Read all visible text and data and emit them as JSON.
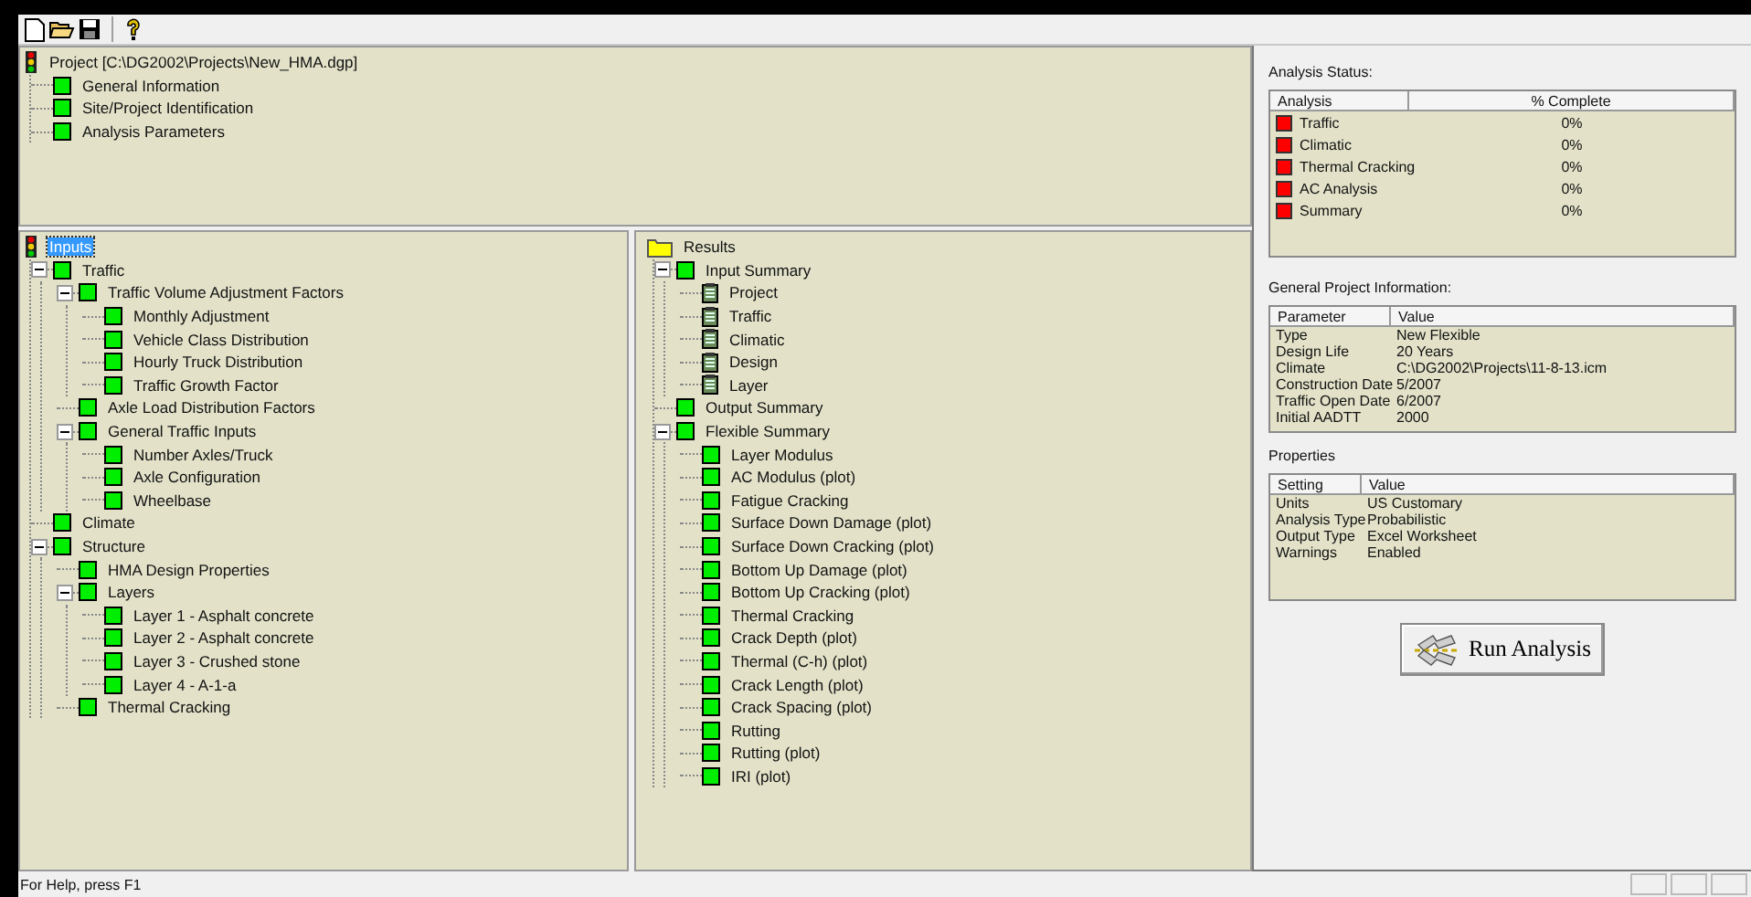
{
  "toolbar": [
    {
      "kind": "new"
    },
    {
      "kind": "open"
    },
    {
      "kind": "save"
    },
    {
      "kind": "separator"
    },
    {
      "kind": "help"
    }
  ],
  "project_tree": {
    "label": "Project [C:\\DG2002\\Projects\\New_HMA.dgp]",
    "kind": "signal",
    "selected": false,
    "children": [
      {
        "label": "General Information",
        "kind": "status",
        "selected": false
      },
      {
        "label": "Site/Project Identification",
        "kind": "status",
        "selected": false
      },
      {
        "label": "Analysis Parameters",
        "kind": "status",
        "selected": false
      }
    ]
  },
  "inputs_tree": {
    "label": "Inputs",
    "kind": "signal",
    "selected": true,
    "children": [
      {
        "label": "Traffic",
        "kind": "status",
        "selected": false,
        "expanded": true,
        "children": [
          {
            "label": "Traffic Volume Adjustment Factors",
            "kind": "status",
            "selected": false,
            "expanded": true,
            "children": [
              {
                "label": "Monthly Adjustment",
                "kind": "status",
                "selected": false
              },
              {
                "label": "Vehicle Class Distribution",
                "kind": "status",
                "selected": false
              },
              {
                "label": "Hourly Truck Distribution",
                "kind": "status",
                "selected": false
              },
              {
                "label": "Traffic Growth Factor",
                "kind": "status",
                "selected": false
              }
            ]
          },
          {
            "label": "Axle Load Distribution Factors",
            "kind": "status",
            "selected": false
          },
          {
            "label": "General Traffic Inputs",
            "kind": "status",
            "selected": false,
            "expanded": true,
            "children": [
              {
                "label": "Number Axles/Truck",
                "kind": "status",
                "selected": false
              },
              {
                "label": "Axle Configuration",
                "kind": "status",
                "selected": false
              },
              {
                "label": "Wheelbase",
                "kind": "status",
                "selected": false
              }
            ]
          }
        ]
      },
      {
        "label": "Climate",
        "kind": "status",
        "selected": false
      },
      {
        "label": "Structure",
        "kind": "status",
        "selected": false,
        "expanded": true,
        "children": [
          {
            "label": "HMA Design Properties",
            "kind": "status",
            "selected": false
          },
          {
            "label": "Layers",
            "kind": "status",
            "selected": false,
            "expanded": true,
            "children": [
              {
                "label": "Layer 1 - Asphalt concrete",
                "kind": "status",
                "selected": false
              },
              {
                "label": "Layer 2 - Asphalt concrete",
                "kind": "status",
                "selected": false
              },
              {
                "label": "Layer 3 - Crushed stone",
                "kind": "status",
                "selected": false
              },
              {
                "label": "Layer 4 - A-1-a",
                "kind": "status",
                "selected": false
              }
            ]
          },
          {
            "label": "Thermal Cracking",
            "kind": "status",
            "selected": false
          }
        ]
      }
    ]
  },
  "results_tree": {
    "label": "Results",
    "kind": "folder",
    "selected": false,
    "children": [
      {
        "label": "Input Summary",
        "kind": "status",
        "selected": false,
        "expanded": true,
        "children": [
          {
            "label": "Project",
            "kind": "notes",
            "selected": false
          },
          {
            "label": "Traffic",
            "kind": "notes",
            "selected": false
          },
          {
            "label": "Climatic",
            "kind": "notes",
            "selected": false
          },
          {
            "label": "Design",
            "kind": "notes",
            "selected": false
          },
          {
            "label": "Layer",
            "kind": "notes",
            "selected": false
          }
        ]
      },
      {
        "label": "Output Summary",
        "kind": "status",
        "selected": false
      },
      {
        "label": "Flexible Summary",
        "kind": "status",
        "selected": false,
        "expanded": true,
        "children": [
          {
            "label": "Layer Modulus",
            "kind": "status",
            "selected": false
          },
          {
            "label": "AC Modulus (plot)",
            "kind": "status",
            "selected": false
          },
          {
            "label": "Fatigue Cracking",
            "kind": "status",
            "selected": false
          },
          {
            "label": "Surface Down Damage (plot)",
            "kind": "status",
            "selected": false
          },
          {
            "label": "Surface Down Cracking (plot)",
            "kind": "status",
            "selected": false
          },
          {
            "label": "Bottom Up Damage (plot)",
            "kind": "status",
            "selected": false
          },
          {
            "label": "Bottom Up Cracking (plot)",
            "kind": "status",
            "selected": false
          },
          {
            "label": "Thermal Cracking",
            "kind": "status",
            "selected": false
          },
          {
            "label": "Crack Depth (plot)",
            "kind": "status",
            "selected": false
          },
          {
            "label": "Thermal (C-h) (plot)",
            "kind": "status",
            "selected": false
          },
          {
            "label": "Crack Length (plot)",
            "kind": "status",
            "selected": false
          },
          {
            "label": "Crack Spacing (plot)",
            "kind": "status",
            "selected": false
          },
          {
            "label": "Rutting",
            "kind": "status",
            "selected": false
          },
          {
            "label": "Rutting (plot)",
            "kind": "status",
            "selected": false
          },
          {
            "label": "IRI (plot)",
            "kind": "status",
            "selected": false
          }
        ]
      }
    ]
  },
  "analysis_status": {
    "title": "Analysis Status:",
    "columns": [
      "Analysis",
      "% Complete"
    ],
    "rows": [
      {
        "name": "Traffic",
        "color": "#ff0000",
        "complete": "0%"
      },
      {
        "name": "Climatic",
        "color": "#ff0000",
        "complete": "0%"
      },
      {
        "name": "Thermal Cracking",
        "color": "#ff0000",
        "complete": "0%"
      },
      {
        "name": "AC Analysis",
        "color": "#ff0000",
        "complete": "0%"
      },
      {
        "name": "Summary",
        "color": "#ff0000",
        "complete": "0%"
      }
    ]
  },
  "general_info": {
    "title": "General Project Information:",
    "columns": [
      "Parameter",
      "Value"
    ],
    "rows": [
      [
        "Type",
        "New Flexible"
      ],
      [
        "Design Life",
        "20 Years"
      ],
      [
        "Climate",
        "C:\\DG2002\\Projects\\11-8-13.icm"
      ],
      [
        "Construction Date",
        "5/2007"
      ],
      [
        "Traffic Open Date",
        "6/2007"
      ],
      [
        "Initial AADTT",
        "2000"
      ]
    ]
  },
  "properties": {
    "title": "Properties",
    "columns": [
      "Setting",
      "Value"
    ],
    "rows": [
      [
        "Units",
        "US Customary"
      ],
      [
        "Analysis Type",
        "Probabilistic"
      ],
      [
        "Output Type",
        "Excel Worksheet"
      ],
      [
        "Warnings",
        "Enabled"
      ]
    ]
  },
  "run_button": {
    "label": "Run Analysis"
  },
  "status_bar": {
    "text": "For Help, press F1"
  }
}
